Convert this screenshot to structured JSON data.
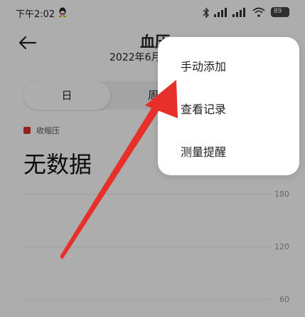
{
  "status_bar": {
    "time": "下午2:02",
    "battery": "89"
  },
  "header": {
    "title": "血压",
    "subtitle": "2022年6月"
  },
  "tabs": [
    {
      "label": "日"
    },
    {
      "label": "周"
    }
  ],
  "legend": {
    "label": "收缩压",
    "color": "#d5332f"
  },
  "main": {
    "no_data": "无数据"
  },
  "axis": {
    "ticks": [
      "180",
      "120",
      "60"
    ]
  },
  "menu": {
    "items": [
      {
        "label": "手动添加"
      },
      {
        "label": "查看记录"
      },
      {
        "label": "测量提醒"
      }
    ]
  },
  "annotation": {
    "arrow_color": "#e8302a"
  }
}
